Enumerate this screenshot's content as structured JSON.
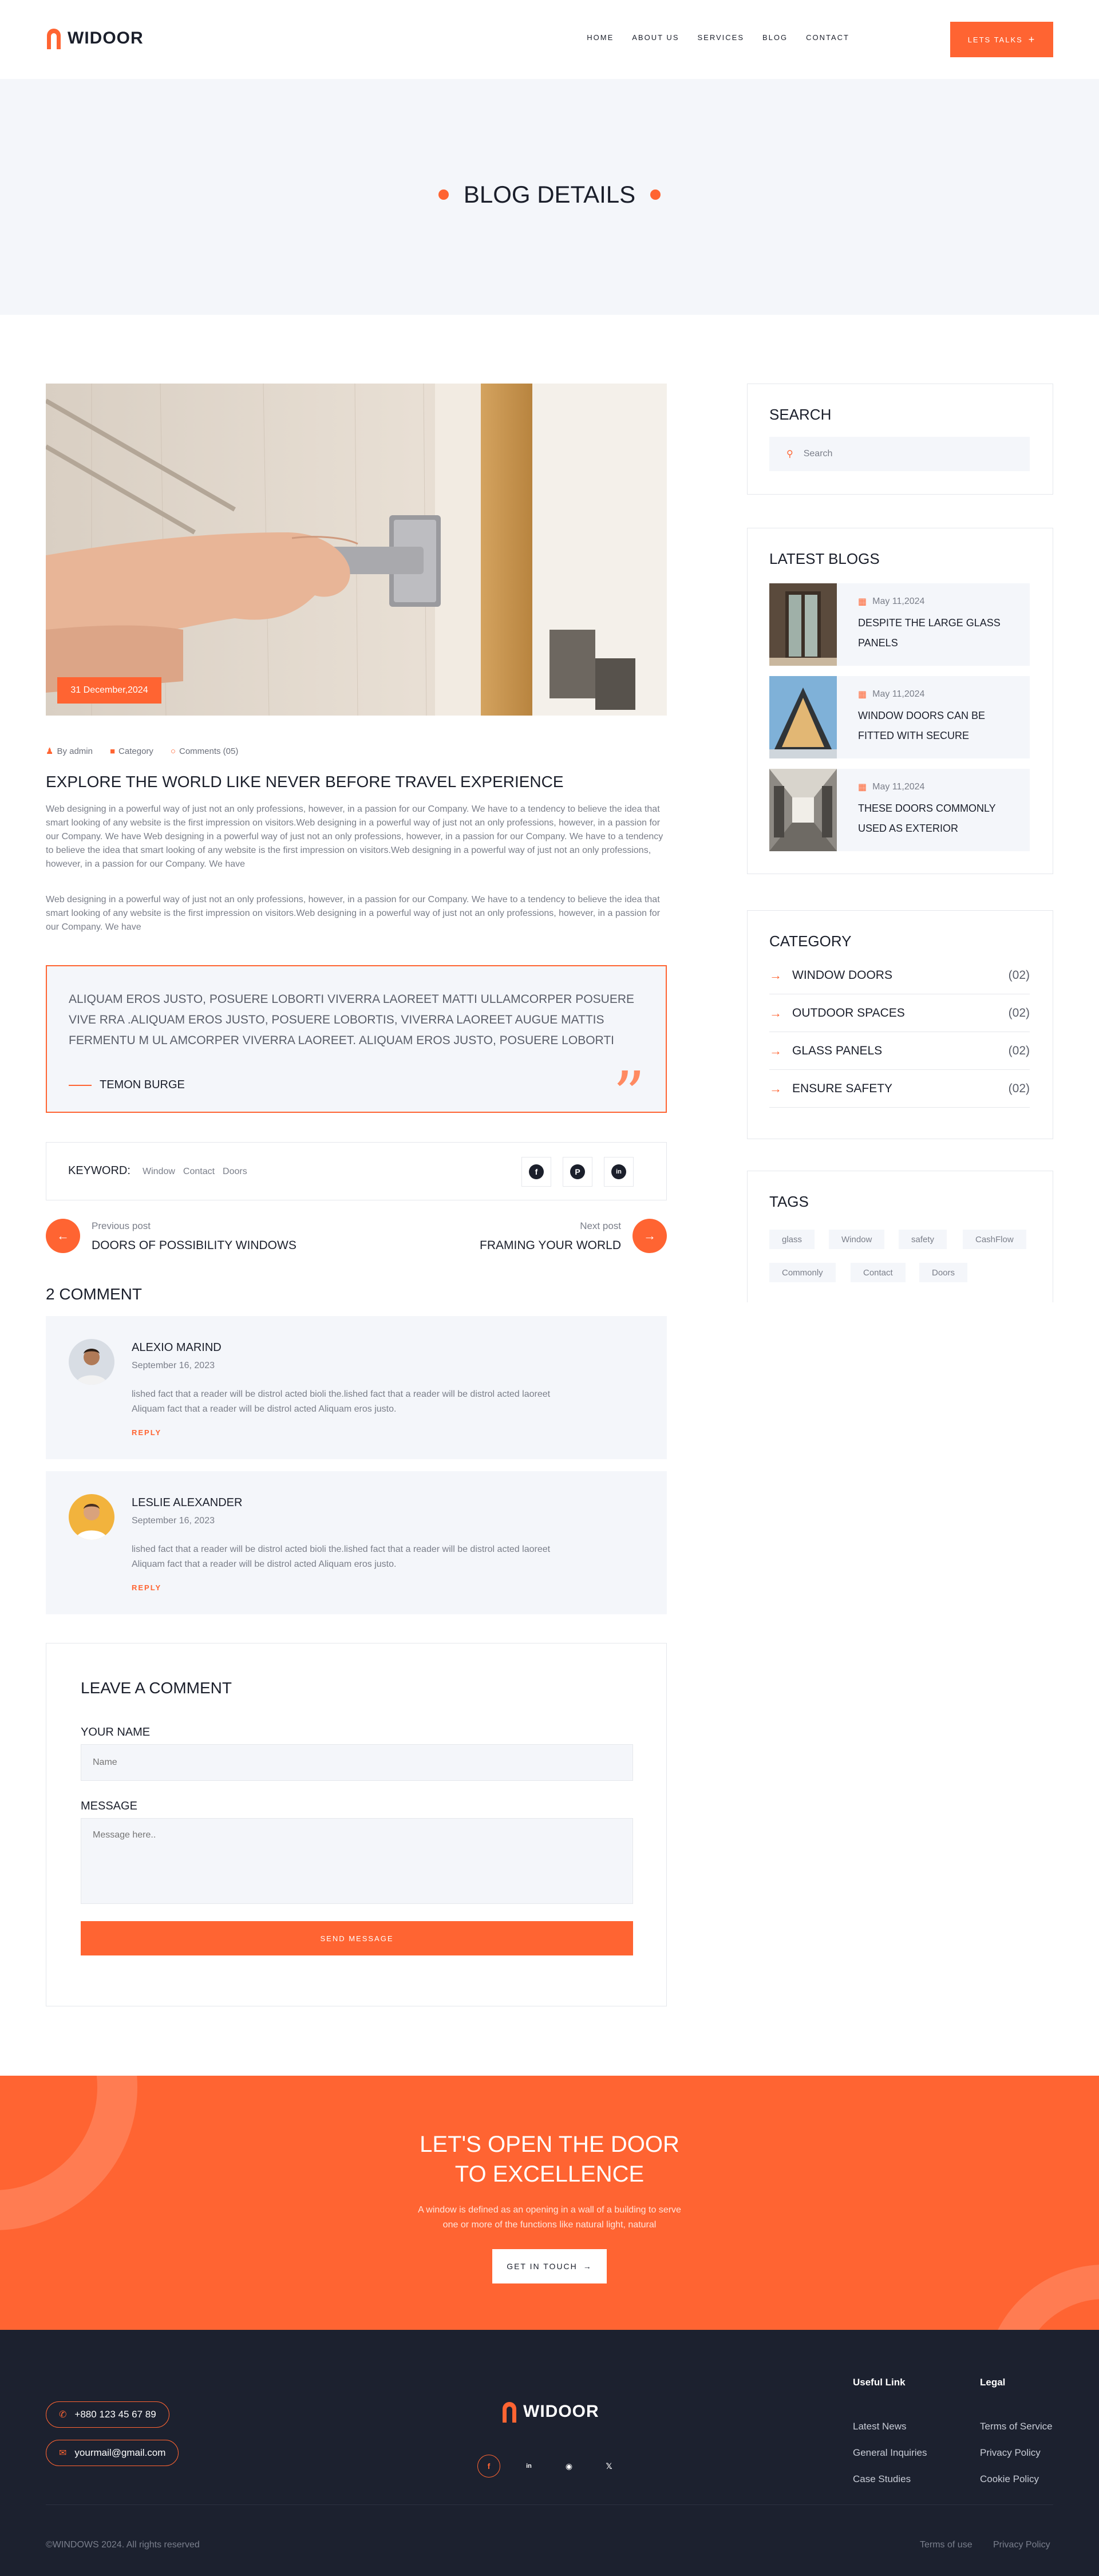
{
  "brand": {
    "name": "WIDOOR",
    "accent": "#ff6432",
    "dark": "#1c212f",
    "light_bg": "#f4f6fa"
  },
  "nav": {
    "items": [
      "HOME",
      "ABOUT US",
      "SERVICES",
      "BLOG",
      "CONTACT"
    ],
    "cta": "LETS TALKS",
    "cta_icon": "plus-icon"
  },
  "hero": {
    "title": "BLOG DETAILS"
  },
  "post": {
    "date": "31 December,2024",
    "author": "By admin",
    "category": "Category",
    "comments": "Comments (05)",
    "title": "EXPLORE THE WORLD LIKE NEVER BEFORE TRAVEL EXPERIENCE",
    "para1": "Web designing in a powerful way of just not an only professions, however, in a passion for our Company. We have to a tendency to believe the idea that smart looking of any website is the first impression on visitors.Web designing in a powerful way of just not an only professions, however, in a passion for our Company. We have Web designing in a powerful way of just not an only professions, however, in a passion for our Company. We have to a tendency to believe the idea that smart looking of any website is the first impression on visitors.Web designing in a powerful way of just not an only professions, however, in a passion for our Company. We have",
    "para2": "Web designing in a powerful way of just not an only professions, however, in a passion for our Company. We have to a tendency to believe the idea that smart looking of any website is the first impression on visitors.Web designing in a powerful way of just not an only professions, however, in a passion for our Company. We have",
    "quote": "ALIQUAM EROS JUSTO, POSUERE LOBORTI VIVERRA LAOREET MATTI ULLAMCORPER POSUERE VIVE RRA .ALIQUAM EROS JUSTO, POSUERE LOBORTIS, VIVERRA LAOREET AUGUE MATTIS FERMENTU M UL AMCORPER VIVERRA LAOREET. ALIQUAM EROS JUSTO, POSUERE LOBORTI",
    "quote_author": "TEMON BURGE",
    "keyword_label": "KEYWORD:",
    "keywords": [
      "Window",
      "Contact",
      "Doors"
    ],
    "share_icons": [
      "facebook-icon",
      "pinterest-icon",
      "linkedin-icon"
    ]
  },
  "post_nav": {
    "prev_label": "Previous post",
    "prev_title": "DOORS OF POSSIBILITY WINDOWS",
    "next_label": "Next post",
    "next_title": "FRAMING YOUR WORLD"
  },
  "comments": {
    "title": "2 COMMENT",
    "items": [
      {
        "name": "ALEXIO MARIND",
        "date": "September 16, 2023",
        "text": "lished fact that a reader will be distrol acted bioli the.lished fact that a reader will be distrol acted laoreet Aliquam fact that a reader will be distrol acted Aliquam eros justo.",
        "reply": "REPLY"
      },
      {
        "name": "LESLIE ALEXANDER",
        "date": "September 16, 2023",
        "text": "lished fact that a reader will be distrol acted bioli the.lished fact that a reader will be distrol acted laoreet Aliquam fact that a reader will be distrol acted Aliquam eros justo.",
        "reply": "REPLY"
      }
    ]
  },
  "comment_form": {
    "title": "LEAVE A COMMENT",
    "name_label": "YOUR NAME",
    "name_placeholder": "Name",
    "message_label": "MESSAGE",
    "message_placeholder": "Message here..",
    "submit": "SEND MESSAGE"
  },
  "sidebar": {
    "search": {
      "title": "SEARCH",
      "placeholder": "Search"
    },
    "latest": {
      "title": "LATEST BLOGS",
      "items": [
        {
          "date": "May 11,2024",
          "title": "DESPITE THE LARGE GLASS PANELS"
        },
        {
          "date": "May 11,2024",
          "title": "WINDOW DOORS CAN BE FITTED WITH SECURE"
        },
        {
          "date": "May 11,2024",
          "title": "THESE DOORS COMMONLY USED AS EXTERIOR"
        }
      ]
    },
    "category": {
      "title": "CATEGORY",
      "items": [
        {
          "name": "WINDOW DOORS",
          "count": "(02)"
        },
        {
          "name": "OUTDOOR SPACES",
          "count": "(02)"
        },
        {
          "name": "GLASS PANELS",
          "count": "(02)"
        },
        {
          "name": "ENSURE SAFETY",
          "count": "(02)"
        }
      ]
    },
    "tags": {
      "title": "TAGS",
      "items": [
        "glass",
        "Window",
        "safety",
        "CashFlow",
        "Commonly",
        "Contact",
        "Doors"
      ]
    }
  },
  "cta": {
    "title_line1": "LET'S OPEN THE DOOR",
    "title_line2": "TO EXCELLENCE",
    "sub_line1": "A window is defined as an opening in a wall of a building to serve",
    "sub_line2": "one or more of the functions like natural light, natural",
    "button": "GET IN TOUCH"
  },
  "footer": {
    "phone": "+880 123 45 67 89",
    "email": "yourmail@gmail.com",
    "socials": [
      "facebook-icon",
      "linkedin-icon",
      "instagram-icon",
      "x-icon"
    ],
    "useful_title": "Useful Link",
    "useful_links": [
      "Latest News",
      "General Inquiries",
      "Case Studies"
    ],
    "legal_title": "Legal",
    "legal_links": [
      "Terms of Service",
      "Privacy Policy",
      "Cookie Policy"
    ],
    "copyright": "©WINDOWS 2024. All rights reserved",
    "bottom_links": [
      "Terms of use",
      "Privacy Policy"
    ]
  }
}
